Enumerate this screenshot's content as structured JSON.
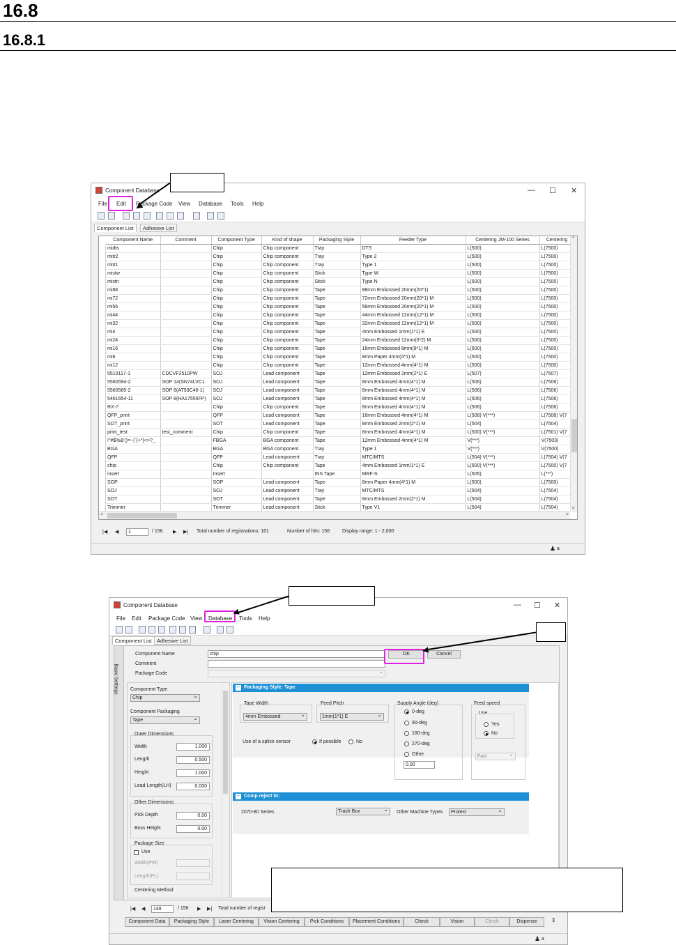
{
  "heading1": "16.8",
  "heading2": "16.8.1",
  "window1": {
    "title": "Component Database",
    "menu": [
      "File",
      "Edit",
      "Package Code",
      "View",
      "Database",
      "Tools",
      "Help"
    ],
    "tabs": [
      "Component List",
      "Adhesive List"
    ],
    "columns": [
      "Component Name",
      "Comment",
      "Component Type",
      "Kind of shape",
      "Packaging Style",
      "Feeder Type",
      "Centering  JM-100 Series",
      "Centering"
    ],
    "rows": [
      [
        "midts",
        "",
        "Chip",
        "Chip component",
        "Tray",
        "DTS",
        "L(500)",
        "L(7500)"
      ],
      [
        "mitr2",
        "",
        "Chip",
        "Chip component",
        "Tray",
        "Type 2",
        "L(500)",
        "L(7500)"
      ],
      [
        "mitr1",
        "",
        "Chip",
        "Chip component",
        "Tray",
        "Type 1",
        "L(500)",
        "L(7500)"
      ],
      [
        "mistw",
        "",
        "Chip",
        "Chip component",
        "Stick",
        "Type W",
        "L(500)",
        "L(7500)"
      ],
      [
        "mistn",
        "",
        "Chip",
        "Chip component",
        "Stick",
        "Type N",
        "L(500)",
        "L(7500)"
      ],
      [
        "mi88",
        "",
        "Chip",
        "Chip component",
        "Tape",
        "88mm Embossed 20mm(20*1)",
        "L(500)",
        "L(7500)"
      ],
      [
        "mi72",
        "",
        "Chip",
        "Chip component",
        "Tape",
        "72mm Embossed 20mm(20*1) M",
        "L(500)",
        "L(7500)"
      ],
      [
        "mi56",
        "",
        "Chip",
        "Chip component",
        "Tape",
        "56mm Embossed 20mm(20*1) M",
        "L(500)",
        "L(7500)"
      ],
      [
        "mi44",
        "",
        "Chip",
        "Chip component",
        "Tape",
        "44mm Embossed 12mm(12*1) M",
        "L(500)",
        "L(7500)"
      ],
      [
        "mi32",
        "",
        "Chip",
        "Chip component",
        "Tape",
        "32mm Embossed 12mm(12*1) M",
        "L(500)",
        "L(7500)"
      ],
      [
        "mi4",
        "",
        "Chip",
        "Chip component",
        "Tape",
        "4mm Embossed 1mm(1*1) E",
        "L(500)",
        "L(7500)"
      ],
      [
        "mi24",
        "",
        "Chip",
        "Chip component",
        "Tape",
        "24mm Embossed 12mm(6*2) M",
        "L(500)",
        "L(7500)"
      ],
      [
        "mi16",
        "",
        "Chip",
        "Chip component",
        "Tape",
        "16mm Embossed 8mm(8*1) M",
        "L(500)",
        "L(7500)"
      ],
      [
        "mi8",
        "",
        "Chip",
        "Chip component",
        "Tape",
        "8mm Paper 4mm(4*1) M",
        "L(500)",
        "L(7500)"
      ],
      [
        "mi12",
        "",
        "Chip",
        "Chip component",
        "Tape",
        "12mm Embossed 4mm(4*1) M",
        "L(500)",
        "L(7500)"
      ],
      [
        "5510117-1",
        "CDCVF2510PW",
        "SOJ",
        "Lead component",
        "Tape",
        "12mm Embossed 2mm(2*1) E",
        "L(507)",
        "L(7507)"
      ],
      [
        "5560594-2",
        "SOP 14(SN74LVC1",
        "SOJ",
        "Lead component",
        "Tape",
        "8mm Embossed 4mm(4*1) M",
        "L(506)",
        "L(7506)"
      ],
      [
        "5560585-2",
        "SOP 8(AT93C46-1(",
        "SOJ",
        "Lead component",
        "Tape",
        "8mm Embossed 4mm(4*1) M",
        "L(506)",
        "L(7506)"
      ],
      [
        "5461654-11",
        "SOP 8(HA17555FP)",
        "SOJ",
        "Lead component",
        "Tape",
        "8mm Embossed 4mm(4*1) M",
        "L(506)",
        "L(7506)"
      ],
      [
        "RX-7",
        "",
        "Chip",
        "Chip component",
        "Tape",
        "8mm Embossed 4mm(4*1) M",
        "L(506)",
        "L(7506)"
      ],
      [
        "QFP_print",
        "",
        "QFP",
        "Lead component",
        "Tape",
        "16mm Embossed 4mm(4*1) M",
        "L(508) V(***)",
        "L(7508) V(7"
      ],
      [
        "SOT_print",
        "",
        "SOT",
        "Lead component",
        "Tape",
        "8mm Embossed 2mm(2*1) M",
        "L(504)",
        "L(7504)"
      ],
      [
        "print_test",
        "test_comment",
        "Chip",
        "Chip component",
        "Tape",
        "8mm Embossed 4mm(4*1) M",
        "L(500) V(***)",
        "L(7501) V(7"
      ],
      [
        "!\"#$%&'()=~|`{+*}<>?_",
        "",
        "FBGA",
        "BGA component",
        "Tape",
        "12mm Embossed 4mm(4*1) M",
        "V(***)",
        "V(7503)"
      ],
      [
        "BGA",
        "",
        "BGA",
        "BGA component",
        "Tray",
        "Type 1",
        "V(***)",
        "V(7500)"
      ],
      [
        "QFP",
        "",
        "QFP",
        "Lead component",
        "Tray",
        "MTC/MTS",
        "L(504) V(***)",
        "L(7504) V(7"
      ],
      [
        "chip",
        "",
        "Chip",
        "Chip component",
        "Tape",
        "4mm Embossed 1mm(1*1) E",
        "L(500) V(***)",
        "L(7500) V(7"
      ],
      [
        "insert",
        "",
        "Insert",
        "",
        "INS Tape",
        "MRF-S",
        "L(505)",
        "L(***)"
      ],
      [
        "SOP",
        "",
        "SOP",
        "Lead component",
        "Tape",
        "8mm Paper 4mm(4*1) M",
        "L(500)",
        "L(7500)"
      ],
      [
        "SOJ",
        "",
        "SOJ",
        "Lead component",
        "Tray",
        "MTC/MTS",
        "L(504)",
        "L(7504)"
      ],
      [
        "SOT",
        "",
        "SOT",
        "Lead component",
        "Tape",
        "8mm Embossed 2mm(2*1) M",
        "L(504)",
        "L(7504)"
      ],
      [
        "Trimmer",
        "",
        "Trimmer",
        "Lead component",
        "Stick",
        "Type V1",
        "L(504)",
        "L(7504)"
      ]
    ],
    "nav": {
      "page": "1",
      "total": "/ 156",
      "registrations": "Total number of registrations: 161",
      "hits": "Number of hits: 156",
      "range": "Display range: 1 - 2,000"
    },
    "status_user": "a"
  },
  "window2": {
    "title": "Component Database",
    "menu": [
      "File",
      "Edit",
      "Package Code",
      "View",
      "Database",
      "Tools",
      "Help"
    ],
    "tabs": [
      "Component List",
      "Adhesive List"
    ],
    "side_label": "Basic Settings",
    "component_name_label": "Component Name",
    "component_name_value": "chip",
    "comment_label": "Comment",
    "package_code_label": "Package Code",
    "ok": "OK",
    "cancel": "Cancel",
    "component_type_label": "Component Type",
    "component_type_value": "Chip",
    "component_packaging_label": "Component Packaging",
    "component_packaging_value": "Tape",
    "outer_dimensions": "Outer Dimensions",
    "width_label": "Width",
    "width_value": "1.000",
    "length_label": "Length",
    "length_value": "0.500",
    "height_label": "Height",
    "height_value": "1.000",
    "lead_label": "Lead Length(LH)",
    "lead_value": "0.000",
    "other_dimensions": "Other Dimensions",
    "pick_depth_label": "Pick Depth",
    "pick_depth_value": "0.00",
    "boss_height_label": "Boss Height",
    "boss_height_value": "0.00",
    "package_size": "Package Size",
    "use_label": "Use",
    "width_pw_label": "Width(PW)",
    "length_pl_label": "Length(PL)",
    "centering_method": "Centering Method",
    "packaging_header": "Packaging Style: Tape",
    "tape_width_label": "Tape Width",
    "tape_width_value": "4mm Embossed",
    "feed_pitch_label": "Feed Pitch",
    "feed_pitch_value": "1mm(1*1) E",
    "supply_angle_label": "Supply Angle (deg)",
    "angles": [
      "0-deg",
      "90-deg",
      "180-deg",
      "270-deg",
      "Other"
    ],
    "angle_other_value": "0.00",
    "feed_speed_label": "Feed speed",
    "feed_use_label": "Use",
    "yes": "Yes",
    "no": "No",
    "fast": "Fast",
    "splice_label": "Use of a splice sensor",
    "if_possible": "If possible",
    "splice_no": "No",
    "reject_header": "Comp reject to:",
    "series_label": "2070-80 Series",
    "trash_value": "Trash Box",
    "other_machine_label": "Other Machine Types",
    "protect_value": "Protect",
    "nav_page": "148",
    "nav_total": "/ 156",
    "nav_reg": "Total number of regist",
    "bottom_tabs": [
      "Component Data",
      "Packaging Style",
      "Laser Centering",
      "Vision Centering",
      "Pick Conditions",
      "Placement Conditions",
      "Check",
      "Vision",
      "Clinch",
      "Dispense"
    ],
    "status_user": "a"
  }
}
